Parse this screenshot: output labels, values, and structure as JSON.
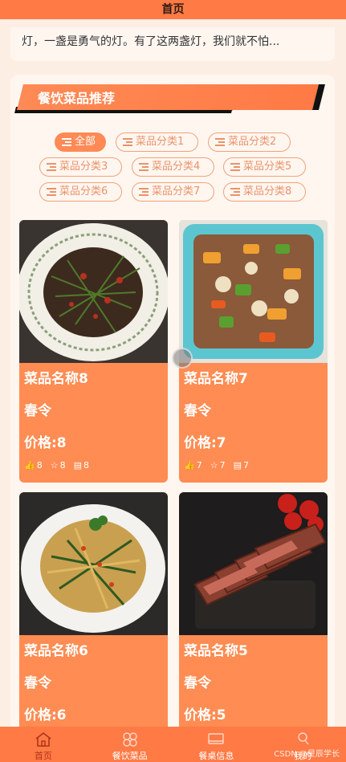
{
  "header": {
    "title": "首页"
  },
  "notice": {
    "text": "灯，一盏是勇气的灯。有了这两盏灯，我们就不怕..."
  },
  "section": {
    "title": "餐饮菜品推荐",
    "chips": [
      "全部",
      "菜品分类1",
      "菜品分类2",
      "菜品分类3",
      "菜品分类4",
      "菜品分类5",
      "菜品分类6",
      "菜品分类7",
      "菜品分类8"
    ]
  },
  "dishes": [
    {
      "name": "菜品名称8",
      "category": "春令",
      "price": "价格:8",
      "likes": "8",
      "favorites": "8",
      "comments": "8"
    },
    {
      "name": "菜品名称7",
      "category": "春令",
      "price": "价格:7",
      "likes": "7",
      "favorites": "7",
      "comments": "7"
    },
    {
      "name": "菜品名称6",
      "category": "春令",
      "price": "价格:6"
    },
    {
      "name": "菜品名称5",
      "category": "春令",
      "price": "价格:5"
    }
  ],
  "tabbar": {
    "items": [
      {
        "label": "首页",
        "icon": "home-icon"
      },
      {
        "label": "餐饮菜品",
        "icon": "grid-icon"
      },
      {
        "label": "餐桌信息",
        "icon": "table-icon"
      },
      {
        "label": "我的",
        "icon": "user-icon"
      }
    ]
  },
  "watermark": "CSDN @星辰学长",
  "colors": {
    "primary": "#ff7a45",
    "card": "#ff8c52",
    "chip_border": "#f0a27a",
    "background": "#fdeee4"
  }
}
